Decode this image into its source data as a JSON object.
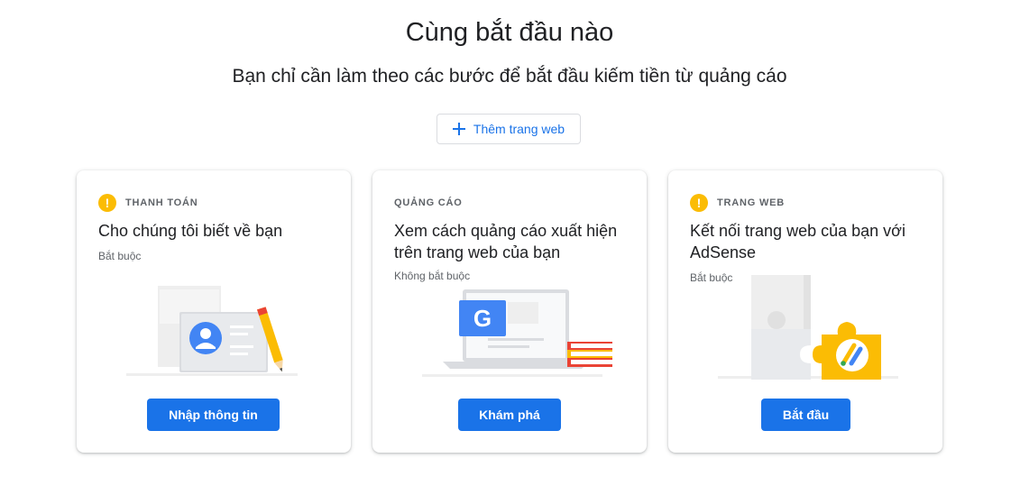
{
  "header": {
    "title": "Cùng bắt đầu nào",
    "subtitle": "Bạn chỉ cần làm theo các bước để bắt đầu kiếm tiền từ quảng cáo",
    "add_site_label": "Thêm trang web"
  },
  "cards": [
    {
      "category": "THANH TOÁN",
      "heading": "Cho chúng tôi biết về bạn",
      "requirement": "Bắt buộc",
      "button": "Nhập thông tin",
      "warning": true
    },
    {
      "category": "QUẢNG CÁO",
      "heading": "Xem cách quảng cáo xuất hiện trên trang web của bạn",
      "requirement": "Không bắt buộc",
      "button": "Khám phá",
      "warning": false
    },
    {
      "category": "TRANG WEB",
      "heading": "Kết nối trang web của bạn với AdSense",
      "requirement": "Bắt buộc",
      "button": "Bắt đầu",
      "warning": true
    }
  ],
  "colors": {
    "primary": "#1a73e8",
    "warning": "#fbbc04",
    "text": "#202124",
    "secondary_text": "#5f6368"
  },
  "icons": {
    "warning": "exclamation-circle",
    "add": "plus",
    "google_logo": "G"
  }
}
